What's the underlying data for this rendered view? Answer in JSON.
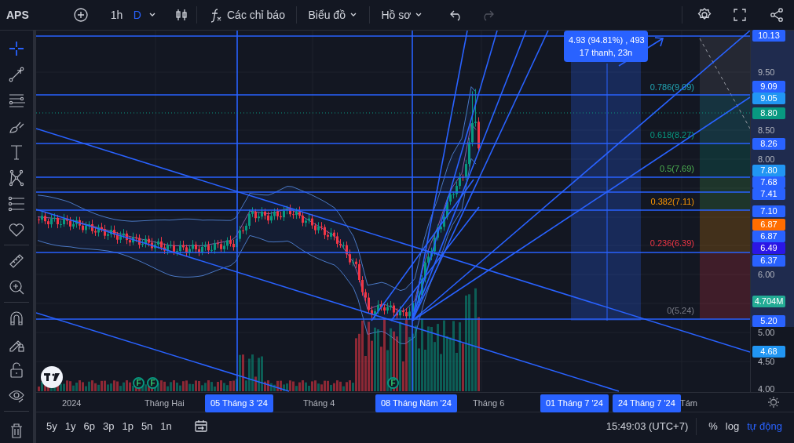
{
  "top_bar": {
    "symbol": "APS",
    "intervals": [
      {
        "label": "1h",
        "selected": false
      },
      {
        "label": "D",
        "selected": true
      }
    ],
    "indicators_label": "Các chỉ báo",
    "chart_menu": "Biểu đồ",
    "profile_menu": "Hồ sơ",
    "undo": {
      "disabled": false
    },
    "redo": {
      "disabled": true
    }
  },
  "drawing_tools": [
    {
      "selected": true
    },
    {
      "selected": false
    },
    {
      "selected": false
    },
    {
      "selected": false
    },
    {
      "selected": false
    },
    {
      "selected": false
    },
    {
      "selected": false
    },
    {
      "selected": false
    },
    {
      "selected": false
    },
    {
      "selected": false
    },
    {
      "selected": false
    },
    {
      "selected": false
    },
    {
      "selected": false
    },
    {
      "selected": false
    },
    {
      "selected": false
    }
  ],
  "measure": {
    "value_line": "4.93 (94.81%) , 493",
    "bars_line": "17 thanh, 23n"
  },
  "fib_levels": [
    {
      "label": "0.786(9.09)",
      "color": "#22a7b5"
    },
    {
      "label": "0.618(8.27)",
      "color": "#089981"
    },
    {
      "label": "0.5(7.69)",
      "color": "#4caf50"
    },
    {
      "label": "0.382(7.11)",
      "color": "#ff9800"
    },
    {
      "label": "0.236(6.39)",
      "color": "#f23645"
    },
    {
      "label": "0(5.24)",
      "color": "#787b86"
    }
  ],
  "events": [
    {
      "label": "F"
    },
    {
      "label": "F"
    },
    {
      "label": "F"
    }
  ],
  "price_axis": {
    "ticks": [
      "9.50",
      "8.50",
      "8.00",
      "6.00",
      "5.00",
      "4.50",
      "4.00"
    ],
    "badges": [
      {
        "label": "10.13",
        "color": "#2962ff"
      },
      {
        "label": "9.09",
        "color": "#2962ff"
      },
      {
        "label": "9.05",
        "color": "#2196f3"
      },
      {
        "label": "8.80",
        "color": "#089981"
      },
      {
        "label": "8.26",
        "color": "#2962ff"
      },
      {
        "label": "7.80",
        "color": "#2196f3"
      },
      {
        "label": "7.68",
        "color": "#2962ff"
      },
      {
        "label": "7.41",
        "color": "#2962ff"
      },
      {
        "label": "7.10",
        "color": "#2962ff"
      },
      {
        "label": "6.87",
        "color": "#ff6d00"
      },
      {
        "label": "6.87",
        "color": "#2962ff"
      },
      {
        "label": "6.49",
        "color": "#2b16e6"
      },
      {
        "label": "6.37",
        "color": "#2962ff"
      },
      {
        "label": "4.704M",
        "color": "#22ab94"
      },
      {
        "label": "5.20",
        "color": "#2962ff"
      },
      {
        "label": "4.68",
        "color": "#2196f3"
      }
    ]
  },
  "time_axis": [
    {
      "label": "2024",
      "kind": "tick"
    },
    {
      "label": "Tháng Hai",
      "kind": "tick"
    },
    {
      "label": "05 Tháng 3 '24",
      "kind": "marker"
    },
    {
      "label": "Tháng 4",
      "kind": "tick"
    },
    {
      "label": "08 Tháng Năm '24",
      "kind": "marker"
    },
    {
      "label": "Tháng 6",
      "kind": "tick"
    },
    {
      "label": "01 Tháng 7 '24",
      "kind": "marker"
    },
    {
      "label": "24 Tháng 7 '24",
      "kind": "marker"
    },
    {
      "label": "Tám",
      "kind": "tick"
    }
  ],
  "bottom_bar": {
    "ranges": [
      "5y",
      "1y",
      "6p",
      "3p",
      "1p",
      "5n",
      "1n"
    ],
    "clock": "15:49:03 (UTC+7)",
    "scale_options": [
      {
        "label": "%",
        "selected": false
      },
      {
        "label": "log",
        "selected": false
      },
      {
        "label": "tự động",
        "selected": true
      }
    ]
  }
}
